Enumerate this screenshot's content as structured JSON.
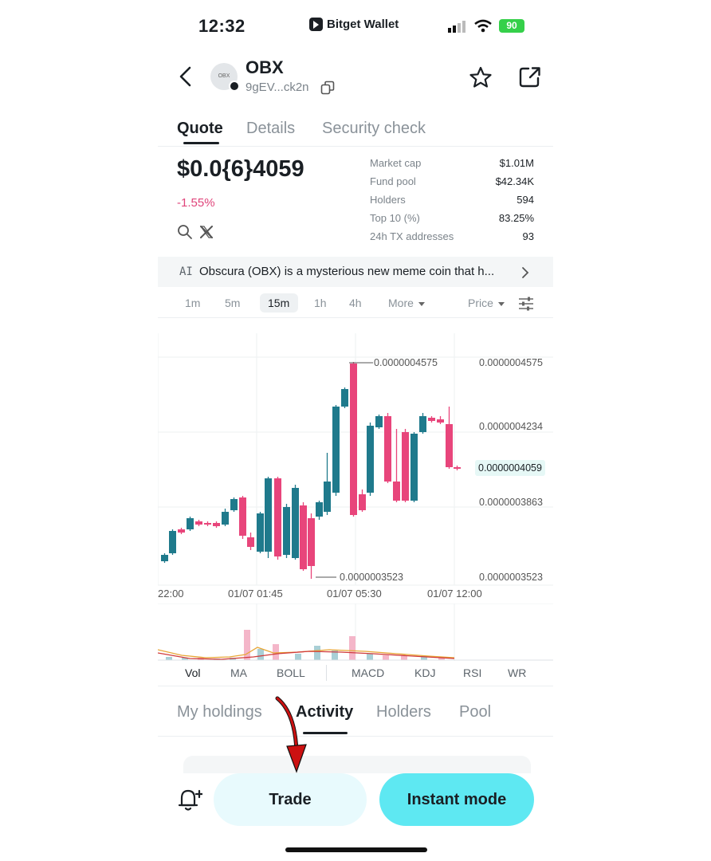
{
  "status": {
    "time": "12:32",
    "app_name": "Bitget Wallet",
    "battery": "90"
  },
  "token": {
    "avatar_text": "OBX",
    "symbol": "OBX",
    "address": "9gEV...ck2n"
  },
  "tabs": [
    "Quote",
    "Details",
    "Security check"
  ],
  "quote": {
    "price": "$0.0{6}4059",
    "change": "-1.55%",
    "stats": [
      {
        "label": "Market cap",
        "value": "$1.01M"
      },
      {
        "label": "Fund pool",
        "value": "$42.34K"
      },
      {
        "label": "Holders",
        "value": "594"
      },
      {
        "label": "Top 10 (%)",
        "value": "83.25%"
      },
      {
        "label": "24h TX addresses",
        "value": "93"
      }
    ]
  },
  "ai": {
    "tag": "AI",
    "text": "Obscura (OBX) is a mysterious new meme coin that h..."
  },
  "timeframes": [
    "1m",
    "5m",
    "15m",
    "1h",
    "4h",
    "More"
  ],
  "price_selector": "Price",
  "chart": {
    "y_labels": [
      "0.0000004575",
      "0.0000004234",
      "0.0000004059",
      "0.0000003863",
      "0.0000003523"
    ],
    "high_label": "0.0000004575",
    "low_label": "0.0000003523",
    "time_labels": [
      "22:00",
      "01/07 01:45",
      "01/07 05:30",
      "01/07 12:00"
    ]
  },
  "chart_data": {
    "type": "candlestick",
    "y_range": [
      3.523e-07,
      4.575e-07
    ],
    "current_price": 4.059e-07,
    "high": 4.575e-07,
    "low": 3.523e-07,
    "up_color": "#1f7a8c",
    "down_color": "#e8457b"
  },
  "indicators": [
    "Vol",
    "MA",
    "BOLL",
    "MACD",
    "KDJ",
    "RSI",
    "WR"
  ],
  "subtabs": [
    "My holdings",
    "Activity",
    "Holders",
    "Pool"
  ],
  "buttons": {
    "trade": "Trade",
    "instant": "Instant mode"
  },
  "colors": {
    "accent": "#5ee8f2",
    "down": "#e0457b",
    "up": "#1f7a8c"
  }
}
